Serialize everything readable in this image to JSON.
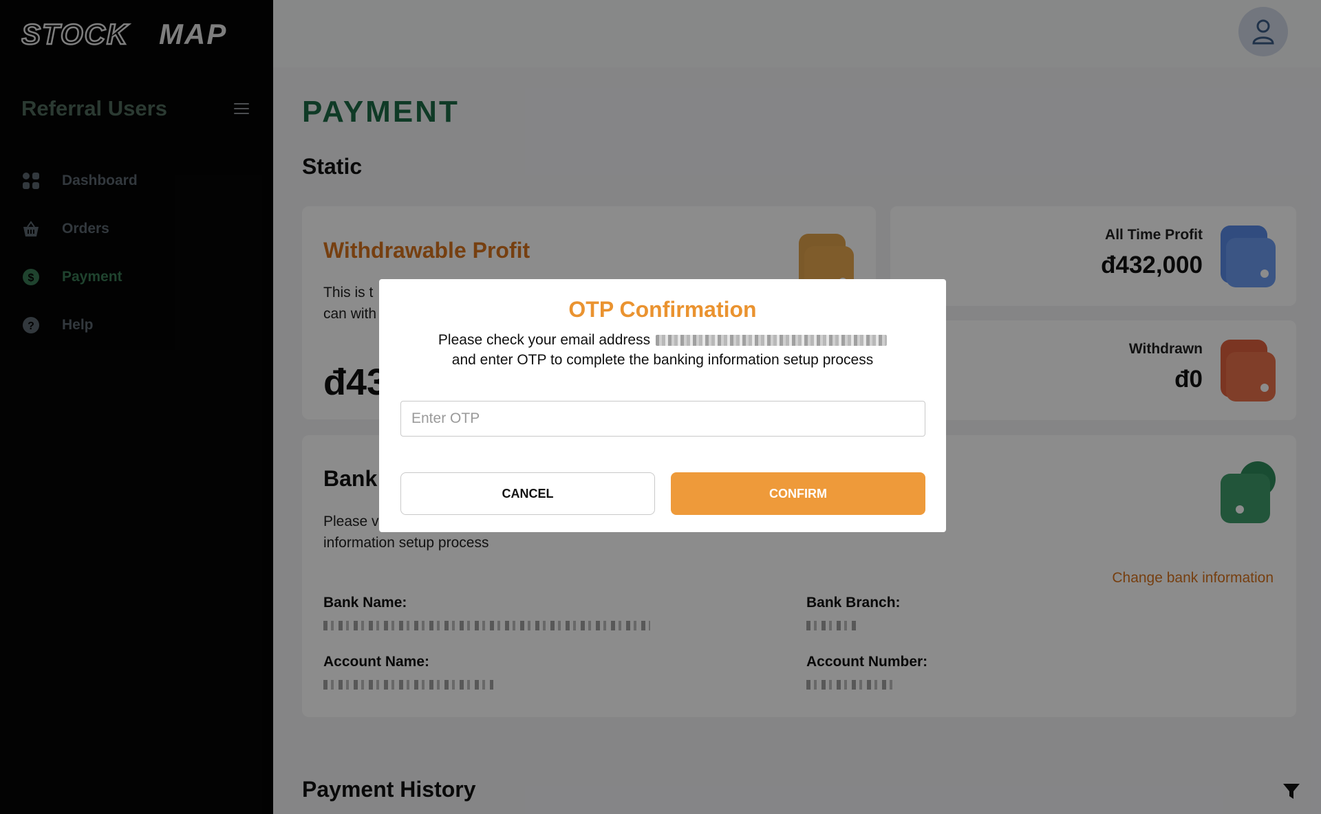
{
  "brand": {
    "logo_text": "STOCKMAP"
  },
  "sidebar": {
    "title": "Referral Users",
    "items": [
      {
        "label": "Dashboard",
        "icon": "grid-icon"
      },
      {
        "label": "Orders",
        "icon": "basket-icon"
      },
      {
        "label": "Payment",
        "icon": "dollar-icon",
        "active": true
      },
      {
        "label": "Help",
        "icon": "help-icon"
      }
    ]
  },
  "main": {
    "page_title": "PAYMENT",
    "section_title": "Static",
    "withdrawable": {
      "title": "Withdrawable Profit",
      "description_visible": "This is t",
      "description_line2": "can with",
      "amount_visible": "đ43"
    },
    "all_time_profit": {
      "label": "All Time Profit",
      "value": "đ432,000"
    },
    "withdrawn": {
      "label": "Withdrawn",
      "value": "đ0"
    },
    "bank": {
      "title": "Bank",
      "description_line1": "Please v",
      "description_line2": "information setup process",
      "change_link": "Change bank information",
      "bank_name_label": "Bank Name:",
      "bank_branch_label": "Bank Branch:",
      "account_name_label": "Account Name:",
      "account_number_label": "Account Number:"
    },
    "history_title": "Payment History"
  },
  "modal": {
    "title": "OTP Confirmation",
    "text_line1": "Please check your email address",
    "text_line2": "and enter OTP to complete the banking information setup process",
    "otp_placeholder": "Enter OTP",
    "cancel_label": "CANCEL",
    "confirm_label": "CONFIRM"
  },
  "colors": {
    "accent_orange": "#ee9a3a",
    "brand_green": "#1c6b45",
    "sidebar_bg": "#050505"
  }
}
